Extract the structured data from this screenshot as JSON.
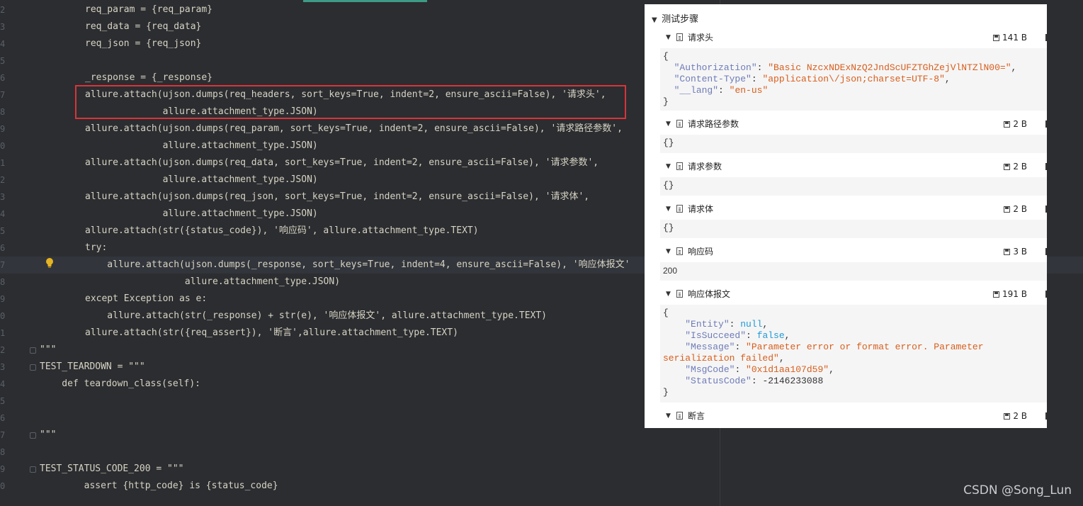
{
  "editor": {
    "line_numbers": [
      "2",
      "3",
      "4",
      "5",
      "6",
      "7",
      "8",
      "9",
      "0",
      "1",
      "2",
      "3",
      "4",
      "5",
      "6",
      "7",
      "8",
      "9",
      "0",
      "1",
      "2",
      "3",
      "4",
      "5",
      "6",
      "7",
      "8",
      "9",
      "0"
    ],
    "lines": [
      "req_param = {req_param}",
      "req_data = {req_data}",
      "req_json = {req_json}",
      "",
      "_response = {_response}",
      "allure.attach(ujson.dumps(req_headers, sort_keys=True, indent=2, ensure_ascii=False), '请求头',",
      "              allure.attachment_type.JSON)",
      "allure.attach(ujson.dumps(req_param, sort_keys=True, indent=2, ensure_ascii=False), '请求路径参数',",
      "              allure.attachment_type.JSON)",
      "allure.attach(ujson.dumps(req_data, sort_keys=True, indent=2, ensure_ascii=False), '请求参数',",
      "              allure.attachment_type.JSON)",
      "allure.attach(ujson.dumps(req_json, sort_keys=True, indent=2, ensure_ascii=False), '请求体',",
      "              allure.attachment_type.JSON)",
      "allure.attach(str({status_code}), '响应码', allure.attachment_type.TEXT)",
      "try:",
      "    allure.attach(ujson.dumps(_response, sort_keys=True, indent=4, ensure_ascii=False), '响应体报文'",
      "                  allure.attachment_type.JSON)",
      "except Exception as e:",
      "    allure.attach(str(_response) + str(e), '响应体报文', allure.attachment_type.TEXT)",
      "allure.attach(str({req_assert}), '断言',allure.attachment_type.TEXT)",
      "\"\"\"",
      "TEST_TEARDOWN = \"\"\"",
      "    def teardown_class(self):",
      "",
      "",
      "\"\"\"",
      "",
      "TEST_STATUS_CODE_200 = \"\"\"",
      "        assert {http_code} is {status_code}"
    ]
  },
  "panel": {
    "title": "测试步骤",
    "attachments": [
      {
        "name": "请求头",
        "size": "141 B"
      },
      {
        "name": "请求路径参数",
        "size": "2 B"
      },
      {
        "name": "请求参数",
        "size": "2 B"
      },
      {
        "name": "请求体",
        "size": "2 B"
      },
      {
        "name": "响应码",
        "size": "3 B"
      },
      {
        "name": "响应体报文",
        "size": "191 B"
      },
      {
        "name": "断言",
        "size": "2 B"
      }
    ],
    "headers_json": {
      "open": "{",
      "k1": "\"Authorization\"",
      "v1": "\"Basic NzcxNDExNzQ2JndScUFZTGhZejVlNTZlN00=\"",
      "k2": "\"Content-Type\"",
      "v2": "\"application\\/json;charset=UTF-8\"",
      "k3": "\"__lang\"",
      "v3": "\"en-us\"",
      "close": "}"
    },
    "empty_obj": "{}",
    "status_code": "200",
    "response_json": {
      "open": "{",
      "k1": "\"Entity\"",
      "v1": "null",
      "k2": "\"IsSucceed\"",
      "v2": "false",
      "k3": "\"Message\"",
      "v3a": "\"Parameter error or format error. Parameter",
      "v3b": "serialization failed\"",
      "k4": "\"MsgCode\"",
      "v4": "\"0x1d1aa107d59\"",
      "k5": "\"StatusCode\"",
      "v5": "-2146233088",
      "close": "}"
    }
  },
  "watermark": "CSDN @Song_Lun"
}
